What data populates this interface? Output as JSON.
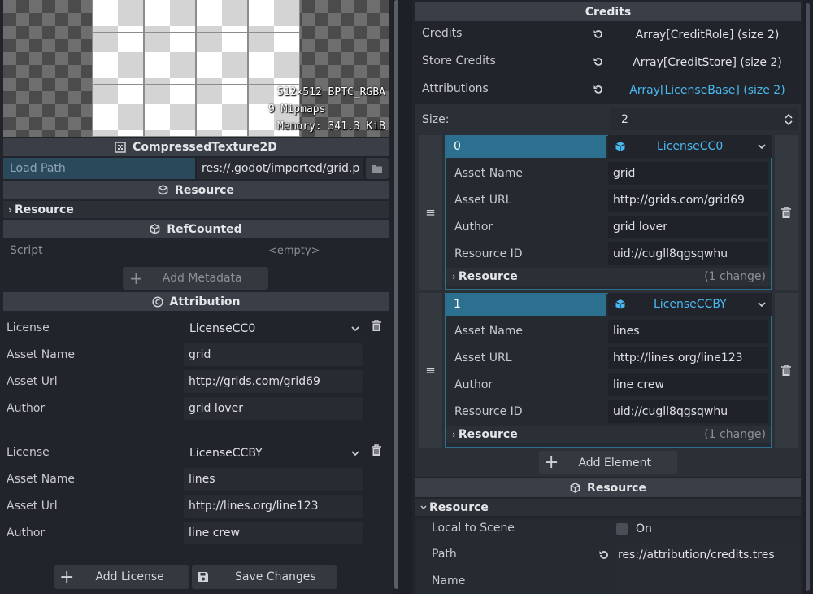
{
  "left": {
    "texture_info": {
      "size": "512×512 BPTC_RGBA",
      "mipmaps": "9 Mipmaps",
      "memory": "Memory: 341.3 KiB"
    },
    "texture_header": "CompressedTexture2D",
    "load_path": {
      "label": "Load Path",
      "value": "res://.godot/imported/grid.p"
    },
    "resource_header": "Resource",
    "resource_sub": "Resource",
    "refcounted_header": "RefCounted",
    "script": {
      "label": "Script",
      "value": "<empty>"
    },
    "add_metadata": "Add Metadata",
    "attribution_header": "Attribution",
    "licenses": [
      {
        "license_label": "License",
        "license": "LicenseCC0",
        "asset_name_label": "Asset Name",
        "asset_name": "grid",
        "asset_url_label": "Asset Url",
        "asset_url": "http://grids.com/grid69",
        "author_label": "Author",
        "author": "grid lover"
      },
      {
        "license_label": "License",
        "license": "LicenseCCBY",
        "asset_name_label": "Asset Name",
        "asset_name": "lines",
        "asset_url_label": "Asset Url",
        "asset_url": "http://lines.org/line123",
        "author_label": "Author",
        "author": "line crew"
      }
    ],
    "add_license": "Add License",
    "save_changes": "Save Changes"
  },
  "right": {
    "credits_header": "Credits",
    "props": [
      {
        "label": "Credits",
        "value": "Array[CreditRole] (size 2)"
      },
      {
        "label": "Store Credits",
        "value": "Array[CreditStore] (size 2)"
      },
      {
        "label": "Attributions",
        "value": "Array[LicenseBase] (size 2)"
      }
    ],
    "size_label": "Size:",
    "size_value": "2",
    "elements": [
      {
        "index": "0",
        "type": "LicenseCC0",
        "asset_name_label": "Asset Name",
        "asset_name": "grid",
        "asset_url_label": "Asset URL",
        "asset_url": "http://grids.com/grid69",
        "author_label": "Author",
        "author": "grid lover",
        "resource_id_label": "Resource ID",
        "resource_id": "uid://cugll8qgsqwhu",
        "resource_label": "Resource",
        "changes": "(1 change)"
      },
      {
        "index": "1",
        "type": "LicenseCCBY",
        "asset_name_label": "Asset Name",
        "asset_name": "lines",
        "asset_url_label": "Asset URL",
        "asset_url": "http://lines.org/line123",
        "author_label": "Author",
        "author": "line crew",
        "resource_id_label": "Resource ID",
        "resource_id": "uid://cugll8qgsqwhu",
        "resource_label": "Resource",
        "changes": "(1 change)"
      }
    ],
    "add_element": "Add Element",
    "resource_header": "Resource",
    "resource_sub": "Resource",
    "local_to_scene": {
      "label": "Local to Scene",
      "value": "On"
    },
    "path": {
      "label": "Path",
      "value": "res://attribution/credits.tres"
    },
    "name": {
      "label": "Name",
      "value": ""
    }
  },
  "colors": {
    "accent": "#4ab8f0",
    "selected": "#2d6f8f",
    "bg": "#1d2027",
    "panel": "#2b2f36"
  }
}
